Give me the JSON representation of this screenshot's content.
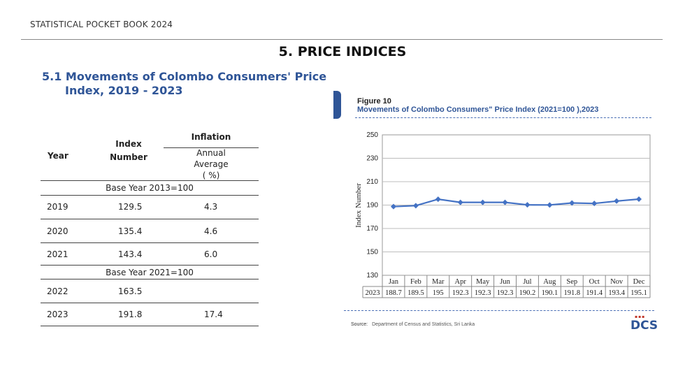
{
  "header": {
    "book_title": "STATISTICAL POCKET BOOK 2024"
  },
  "chapter": {
    "title": "5.  PRICE INDICES"
  },
  "section": {
    "title_line1": "5.1  Movements of Colombo Consumers' Price",
    "title_line2": "Index, 2019 - 2023"
  },
  "table": {
    "headers": {
      "year": "Year",
      "index_line1": "Index",
      "index_line2": "Number",
      "inflation": "Inflation",
      "annual_line1": "Annual",
      "annual_line2": "Average",
      "annual_line3": "( %)"
    },
    "base_2013": "Base Year 2013=100",
    "base_2021": "Base Year 2021=100",
    "rows": [
      {
        "year": "2019",
        "index": "129.5",
        "inflation": "4.3"
      },
      {
        "year": "2020",
        "index": "135.4",
        "inflation": "4.6"
      },
      {
        "year": "2021",
        "index": "143.4",
        "inflation": "6.0"
      },
      {
        "year": "2022",
        "index": "163.5",
        "inflation": ""
      },
      {
        "year": "2023",
        "index": "191.8",
        "inflation": "17.4"
      }
    ]
  },
  "figure": {
    "label": "Figure 10",
    "title": "Movements of Colombo Consumers\" Price Index (2021=100 ),2023"
  },
  "source": {
    "label": "Source:",
    "text": "Department of Census and Statistics, Sri Lanka"
  },
  "logo": {
    "text": "DCS"
  },
  "colors": {
    "accent": "#2f5597",
    "line": "#4472c4"
  },
  "chart_data": {
    "type": "line",
    "categories": [
      "Jan",
      "Feb",
      "Mar",
      "Apr",
      "May",
      "Jun",
      "Jul",
      "Aug",
      "Sep",
      "Oct",
      "Nov",
      "Dec"
    ],
    "series": [
      {
        "name": "2023",
        "values": [
          188.7,
          189.5,
          195,
          192.3,
          192.3,
          192.3,
          190.2,
          190.1,
          191.8,
          191.4,
          193.4,
          195.1
        ],
        "display_values": [
          "188.7",
          "189.5",
          "195",
          "192.3",
          "192.3",
          "192.3",
          "190.2",
          "190.1",
          "191.8",
          "191.4",
          "193.4",
          "195.1"
        ]
      }
    ],
    "ylabel": "Index Number",
    "ylim": [
      130,
      250
    ],
    "yticks": [
      130,
      150,
      170,
      190,
      210,
      230,
      250
    ],
    "grid": true,
    "legend": "data-table"
  }
}
